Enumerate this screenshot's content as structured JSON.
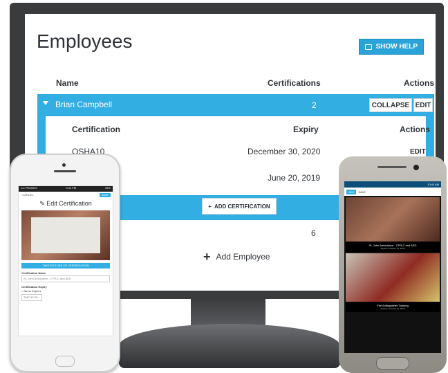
{
  "app": {
    "title": "Employees",
    "help_button": "SHOW HELP"
  },
  "table": {
    "headers": {
      "name": "Name",
      "certifications": "Certifications",
      "actions": "Actions"
    },
    "employees": [
      {
        "name": "Brian Campbell",
        "count": "2",
        "collapse": "COLLAPSE",
        "edit": "EDIT"
      }
    ],
    "second_count": "6"
  },
  "cert_table": {
    "headers": {
      "certification": "Certification",
      "expiry": "Expiry",
      "actions": "Actions"
    },
    "rows": [
      {
        "name": "OSHA10",
        "expiry": "December 30, 2020",
        "action": "EDIT"
      },
      {
        "name": "",
        "expiry": "June 20, 2019",
        "action": ""
      }
    ],
    "add_button": "ADD CERTIFICATION"
  },
  "add_employee": "Add Employee",
  "iphone": {
    "status_left": "•••• PHONES",
    "status_time": "9:41 PM",
    "status_right": "33%",
    "nav_back": "‹ CANCEL",
    "nav_save": "SAVE",
    "title": "Edit Certification",
    "photo_button": "TAKE PICTURE OF CERTIFICATION",
    "name_label": "Certification Name",
    "name_value": "St. John Ambulance - CPR-C and AED",
    "expiry_label": "Certification Expiry",
    "never_expires": "Never Expires",
    "date_value": "2017-12-20"
  },
  "android": {
    "status_time": "10:40 AM",
    "nav_add": "ADD",
    "nav_label": "SAVE",
    "cards": [
      {
        "title": "St. John Ambulance - CPR-C and AED",
        "subtitle": "Expires: October 12, 2018"
      },
      {
        "title": "Fire Extinguisher Training",
        "subtitle": "Expires: October 31, 2018"
      }
    ]
  },
  "colors": {
    "accent": "#32aee3",
    "text": "#2f3338",
    "monitor": "#3a3b3d"
  }
}
